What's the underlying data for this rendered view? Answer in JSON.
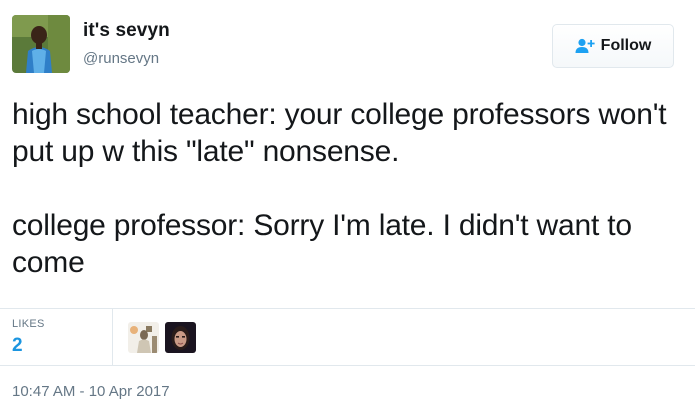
{
  "author": {
    "display_name": "it's sevyn",
    "handle": "@runsevyn",
    "avatar_icon": "profile-photo"
  },
  "follow_button": {
    "label": "Follow",
    "icon": "add-user-icon",
    "icon_color": "#1da1f2"
  },
  "tweet": {
    "lines_1": "high school teacher: your college professors won't put up w this \"late\" nonsense.",
    "lines_2": "college professor: Sorry I'm late. I didn't want to come"
  },
  "stats": {
    "likes_label": "LIKES",
    "likes_count": "2",
    "accent": "#1b95e0"
  },
  "likers": [
    {
      "icon": "liker-avatar-1"
    },
    {
      "icon": "liker-avatar-2"
    }
  ],
  "timestamp": "10:47 AM - 10 Apr 2017"
}
